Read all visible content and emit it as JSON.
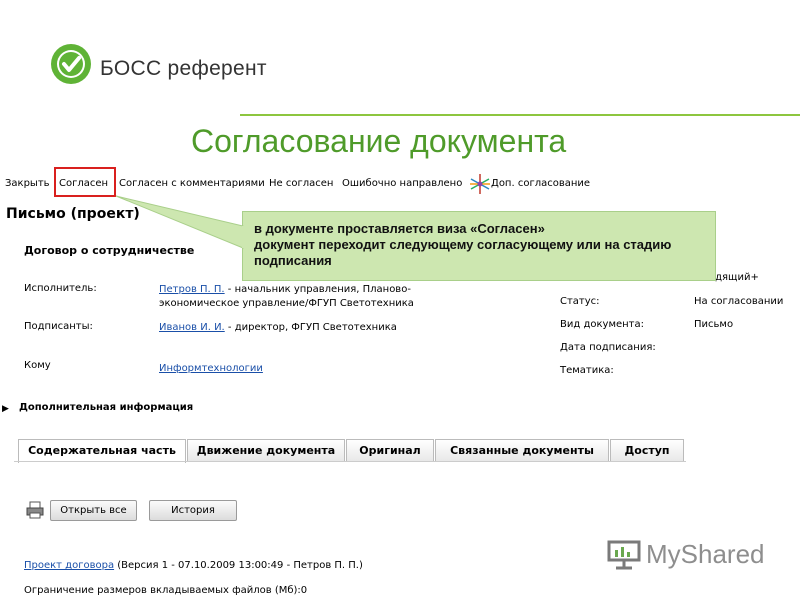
{
  "brand": {
    "name": "БОСС референт",
    "color": "#4f9b2a"
  },
  "slide_title": "Согласование документа",
  "toolbar": {
    "close": "Закрыть",
    "agree": "Согласен",
    "agree_comments": "Согласен с комментариями",
    "disagree": "Не согласен",
    "wrong": "Ошибочно направлено",
    "add_approval": "Доп. согласование"
  },
  "document": {
    "title": "Письмо (проект)",
    "contract": "Договор о сотрудничестве",
    "executor_label": "Исполнитель:",
    "executor_name": "Петров П. П.",
    "executor_desc": " - начальник управления, Планово-экономическое управление/ФГУП Светотехника",
    "signers_label": "Подписанты:",
    "signer_name": "Иванов И. И.",
    "signer_desc": " - директор, ФГУП Светотехника",
    "to_label": "Кому",
    "to_value": "Информтехнологии",
    "right_partial": "одящий+",
    "status_label": "Статус:",
    "status_value": "На согласовании",
    "doctype_label": "Вид документа:",
    "doctype_value": "Письмо",
    "sign_date_label": "Дата подписания:",
    "topic_label": "Тематика:"
  },
  "callout": {
    "line1": "в документе проставляется виза «Согласен»",
    "line2": "документ переходит следующему согласующему или на стадию подписания"
  },
  "additional_info": "Дополнительная информация",
  "tabs": [
    "Содержательная часть",
    "Движение документа",
    "Оригинал",
    "Связанные документы",
    "Доступ"
  ],
  "buttons": {
    "open_all": "Открыть все",
    "history": "История"
  },
  "project": {
    "link": "Проект договора",
    "version": " (Версия 1 - 07.10.2009 13:00:49 - Петров П. П.)"
  },
  "limit": "Ограничение размеров вкладываемых файлов (Мб):0",
  "watermark": "MyShared",
  "icons": {
    "logo": "check-circle-icon",
    "add_approval": "star-icon",
    "print": "printer-icon",
    "expand": "triangle-right-icon",
    "watermark": "presentation-icon"
  }
}
